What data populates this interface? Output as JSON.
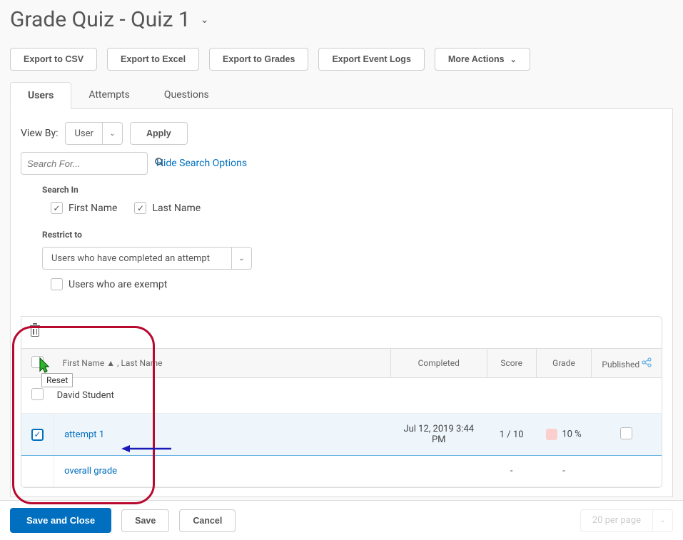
{
  "page_title": "Grade Quiz - Quiz 1",
  "toolbar": {
    "export_csv": "Export to CSV",
    "export_excel": "Export to Excel",
    "export_grades": "Export to Grades",
    "export_event_logs": "Export Event Logs",
    "more_actions": "More Actions"
  },
  "tabs": {
    "users": "Users",
    "attempts": "Attempts",
    "questions": "Questions"
  },
  "viewby": {
    "label": "View By:",
    "value": "User",
    "apply": "Apply"
  },
  "search": {
    "placeholder": "Search For...",
    "hide_options": "Hide Search Options"
  },
  "search_in": {
    "heading": "Search In",
    "firstname": "First Name",
    "lastname": "Last Name"
  },
  "restrict": {
    "heading": "Restrict to",
    "select_value": "Users who have completed an attempt",
    "exempt": "Users who are exempt"
  },
  "tooltip": "Reset",
  "columns": {
    "name": "First Name ▲ , Last Name",
    "completed": "Completed",
    "score": "Score",
    "grade": "Grade",
    "published": "Published"
  },
  "rows": {
    "student_name": "David Student",
    "attempt_label": "attempt 1",
    "attempt_completed": "Jul 12, 2019 3:44 PM",
    "attempt_score": "1 / 10",
    "attempt_grade": "10 %",
    "overall_label": "overall grade",
    "overall_score": "-",
    "overall_grade": "-"
  },
  "footer": {
    "save_close": "Save and Close",
    "save": "Save",
    "cancel": "Cancel",
    "per_page": "20 per page"
  }
}
